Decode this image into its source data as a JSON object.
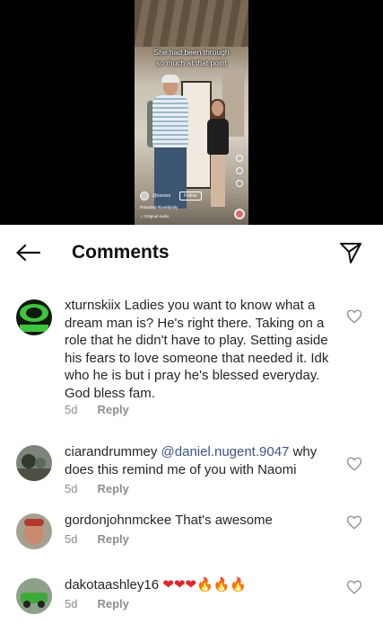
{
  "video": {
    "caption_lines": [
      "She had been through",
      "so much at that point"
    ],
    "username": "@xxxxxx",
    "follow_label": "Follow",
    "meta_line1": "#stepdad #lovefamily",
    "meta_line2": "♫ Original audio"
  },
  "header": {
    "title": "Comments"
  },
  "comments": [
    {
      "username": "xturnskiix",
      "text": " Ladies you want to know what a dream man is? He's right there. Taking on a role that he didn't have to play. Setting aside his fears to love someone that needed it. Idk who he is but i pray he's blessed everyday. God bless fam.",
      "mention": "",
      "time": "5d",
      "reply_label": "Reply",
      "avatar": "green-logo"
    },
    {
      "username": "ciarandrummey",
      "mention": "@daniel.nugent.9047",
      "text": "  why does this remind me of you with Naomi",
      "time": "5d",
      "reply_label": "Reply",
      "avatar": "outdoor-photo"
    },
    {
      "username": "gordonjohnmckee",
      "mention": "",
      "text": " That's awesome",
      "time": "5d",
      "reply_label": "Reply",
      "avatar": "face-photo"
    },
    {
      "username": "dakotaashley16",
      "mention": "",
      "text": " ",
      "emojis": "❤❤❤🔥🔥🔥",
      "time": "5d",
      "reply_label": "Reply",
      "avatar": "car-photo"
    }
  ],
  "colors": {
    "text": "#262626",
    "meta": "#8e8e8e",
    "mention": "#3e5586",
    "heart": "#e0262b",
    "fire": "#f06a18"
  },
  "icons": [
    "back-arrow-icon",
    "send-icon",
    "heart-outline-icon"
  ]
}
